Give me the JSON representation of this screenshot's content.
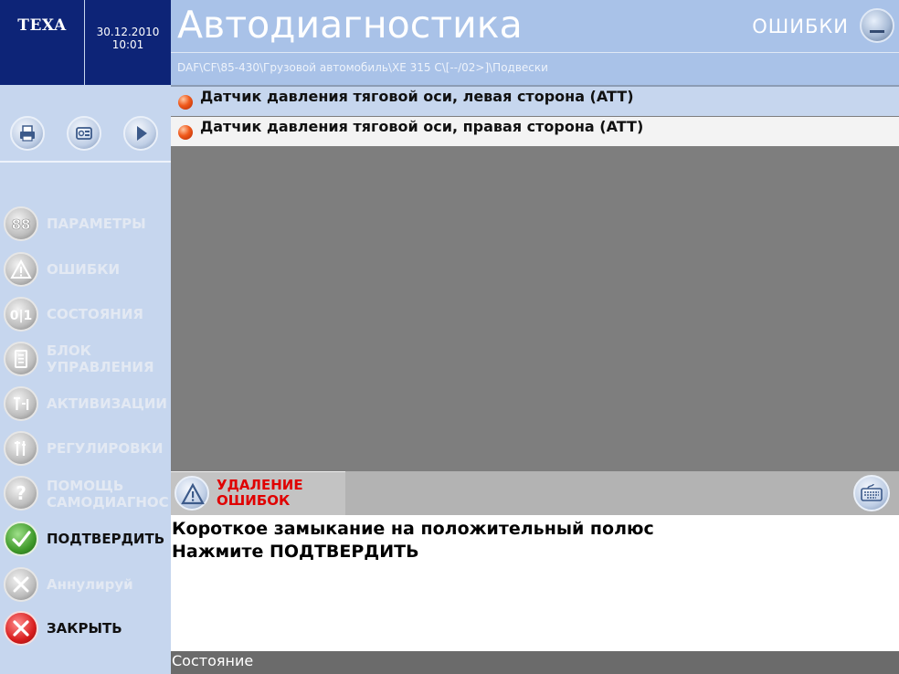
{
  "brand": {
    "logo_text": "TEXA"
  },
  "datetime": {
    "date": "30.12.2010",
    "time": "10:01"
  },
  "header": {
    "title": "Автодиагностика",
    "mode": "ОШИБКИ",
    "path": "DAF\\CF\\85-430\\Грузовой автомобиль\\XE 315 C\\[--/02>]\\Подвески"
  },
  "toolbar": {
    "icons": [
      "printer-icon",
      "snapshot-icon",
      "play-icon"
    ]
  },
  "menu": {
    "items": [
      {
        "label": "ПАРАМЕТРЫ",
        "icon": "gauge-88-icon",
        "enabled": false
      },
      {
        "label": "ОШИБКИ",
        "icon": "warning-icon",
        "enabled": false
      },
      {
        "label": "СОСТОЯНИЯ",
        "icon": "switch-01-icon",
        "enabled": false
      },
      {
        "label": "БЛОК",
        "label2": "УПРАВЛЕНИЯ",
        "icon": "ecu-icon",
        "enabled": false
      },
      {
        "label": "АКТИВИЗАЦИИ",
        "icon": "activation-icon",
        "enabled": false
      },
      {
        "label": "РЕГУЛИРОВКИ",
        "icon": "adjust-icon",
        "enabled": false
      },
      {
        "label": "ПОМОЩЬ",
        "label2": "САМОДИАГНОС",
        "icon": "help-icon",
        "enabled": false
      },
      {
        "label": "ПОДТВЕРДИТЬ",
        "icon": "check-icon",
        "enabled": true
      },
      {
        "label": "Аннулируй",
        "icon": "cancel-icon",
        "enabled": false
      },
      {
        "label": "ЗАКРЫТЬ",
        "icon": "close-icon",
        "enabled": true
      }
    ]
  },
  "errors": [
    {
      "text": "Датчик давления тяговой оси, левая сторона (ATT)",
      "status_color": "#f05a1c"
    },
    {
      "text": "Датчик давления тяговой оси, правая сторона (ATT)",
      "status_color": "#f05a1c"
    }
  ],
  "action": {
    "title_line1": "УДАЛЕНИЕ",
    "title_line2": "ОШИБОК",
    "title_color": "#e00000"
  },
  "message": {
    "line1": "Короткое замыкание на положительный полюс",
    "line2": "Нажмите ПОДТВЕРДИТЬ"
  },
  "status": {
    "label": "Состояние"
  }
}
